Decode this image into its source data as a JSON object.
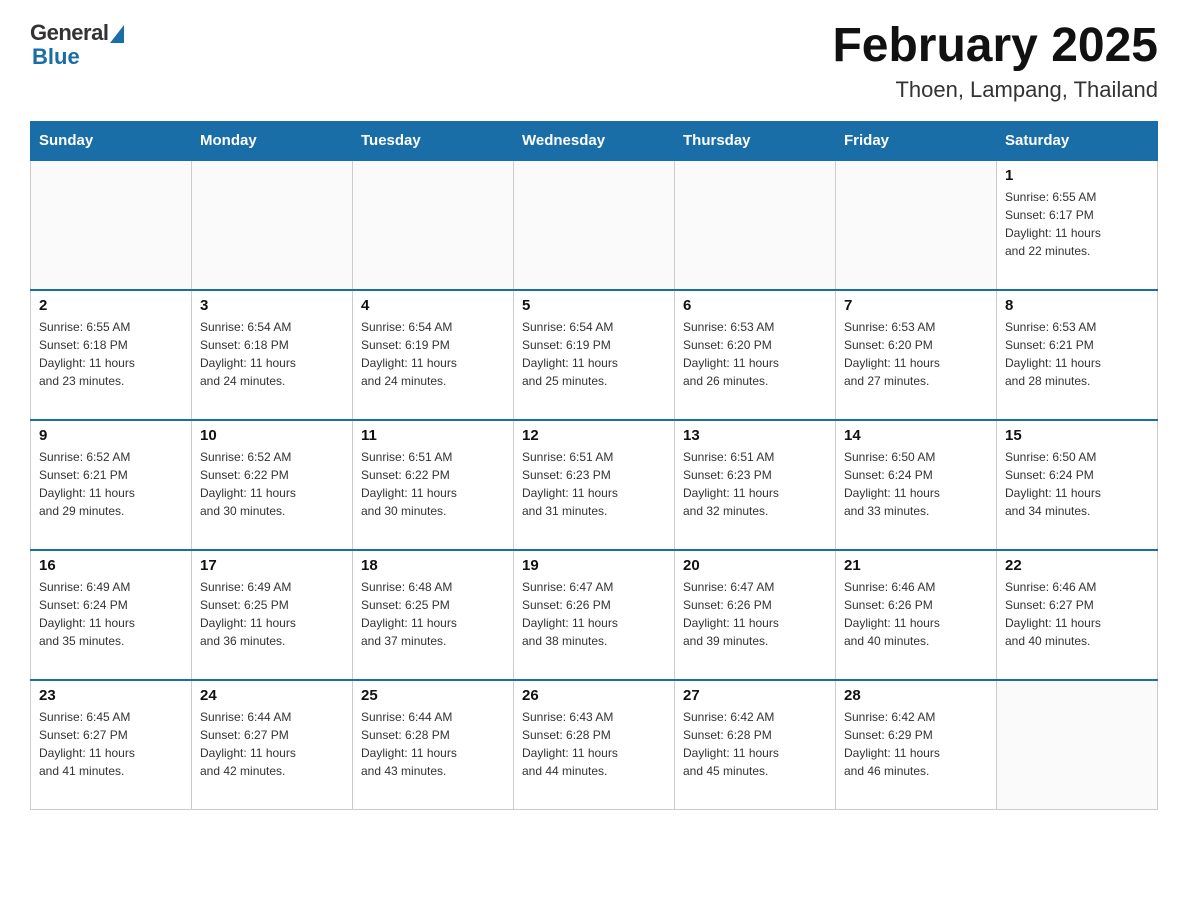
{
  "header": {
    "logo_general": "General",
    "logo_blue": "Blue",
    "month_title": "February 2025",
    "location": "Thoen, Lampang, Thailand"
  },
  "calendar": {
    "days_of_week": [
      "Sunday",
      "Monday",
      "Tuesday",
      "Wednesday",
      "Thursday",
      "Friday",
      "Saturday"
    ],
    "weeks": [
      [
        {
          "day": "",
          "info": ""
        },
        {
          "day": "",
          "info": ""
        },
        {
          "day": "",
          "info": ""
        },
        {
          "day": "",
          "info": ""
        },
        {
          "day": "",
          "info": ""
        },
        {
          "day": "",
          "info": ""
        },
        {
          "day": "1",
          "info": "Sunrise: 6:55 AM\nSunset: 6:17 PM\nDaylight: 11 hours\nand 22 minutes."
        }
      ],
      [
        {
          "day": "2",
          "info": "Sunrise: 6:55 AM\nSunset: 6:18 PM\nDaylight: 11 hours\nand 23 minutes."
        },
        {
          "day": "3",
          "info": "Sunrise: 6:54 AM\nSunset: 6:18 PM\nDaylight: 11 hours\nand 24 minutes."
        },
        {
          "day": "4",
          "info": "Sunrise: 6:54 AM\nSunset: 6:19 PM\nDaylight: 11 hours\nand 24 minutes."
        },
        {
          "day": "5",
          "info": "Sunrise: 6:54 AM\nSunset: 6:19 PM\nDaylight: 11 hours\nand 25 minutes."
        },
        {
          "day": "6",
          "info": "Sunrise: 6:53 AM\nSunset: 6:20 PM\nDaylight: 11 hours\nand 26 minutes."
        },
        {
          "day": "7",
          "info": "Sunrise: 6:53 AM\nSunset: 6:20 PM\nDaylight: 11 hours\nand 27 minutes."
        },
        {
          "day": "8",
          "info": "Sunrise: 6:53 AM\nSunset: 6:21 PM\nDaylight: 11 hours\nand 28 minutes."
        }
      ],
      [
        {
          "day": "9",
          "info": "Sunrise: 6:52 AM\nSunset: 6:21 PM\nDaylight: 11 hours\nand 29 minutes."
        },
        {
          "day": "10",
          "info": "Sunrise: 6:52 AM\nSunset: 6:22 PM\nDaylight: 11 hours\nand 30 minutes."
        },
        {
          "day": "11",
          "info": "Sunrise: 6:51 AM\nSunset: 6:22 PM\nDaylight: 11 hours\nand 30 minutes."
        },
        {
          "day": "12",
          "info": "Sunrise: 6:51 AM\nSunset: 6:23 PM\nDaylight: 11 hours\nand 31 minutes."
        },
        {
          "day": "13",
          "info": "Sunrise: 6:51 AM\nSunset: 6:23 PM\nDaylight: 11 hours\nand 32 minutes."
        },
        {
          "day": "14",
          "info": "Sunrise: 6:50 AM\nSunset: 6:24 PM\nDaylight: 11 hours\nand 33 minutes."
        },
        {
          "day": "15",
          "info": "Sunrise: 6:50 AM\nSunset: 6:24 PM\nDaylight: 11 hours\nand 34 minutes."
        }
      ],
      [
        {
          "day": "16",
          "info": "Sunrise: 6:49 AM\nSunset: 6:24 PM\nDaylight: 11 hours\nand 35 minutes."
        },
        {
          "day": "17",
          "info": "Sunrise: 6:49 AM\nSunset: 6:25 PM\nDaylight: 11 hours\nand 36 minutes."
        },
        {
          "day": "18",
          "info": "Sunrise: 6:48 AM\nSunset: 6:25 PM\nDaylight: 11 hours\nand 37 minutes."
        },
        {
          "day": "19",
          "info": "Sunrise: 6:47 AM\nSunset: 6:26 PM\nDaylight: 11 hours\nand 38 minutes."
        },
        {
          "day": "20",
          "info": "Sunrise: 6:47 AM\nSunset: 6:26 PM\nDaylight: 11 hours\nand 39 minutes."
        },
        {
          "day": "21",
          "info": "Sunrise: 6:46 AM\nSunset: 6:26 PM\nDaylight: 11 hours\nand 40 minutes."
        },
        {
          "day": "22",
          "info": "Sunrise: 6:46 AM\nSunset: 6:27 PM\nDaylight: 11 hours\nand 40 minutes."
        }
      ],
      [
        {
          "day": "23",
          "info": "Sunrise: 6:45 AM\nSunset: 6:27 PM\nDaylight: 11 hours\nand 41 minutes."
        },
        {
          "day": "24",
          "info": "Sunrise: 6:44 AM\nSunset: 6:27 PM\nDaylight: 11 hours\nand 42 minutes."
        },
        {
          "day": "25",
          "info": "Sunrise: 6:44 AM\nSunset: 6:28 PM\nDaylight: 11 hours\nand 43 minutes."
        },
        {
          "day": "26",
          "info": "Sunrise: 6:43 AM\nSunset: 6:28 PM\nDaylight: 11 hours\nand 44 minutes."
        },
        {
          "day": "27",
          "info": "Sunrise: 6:42 AM\nSunset: 6:28 PM\nDaylight: 11 hours\nand 45 minutes."
        },
        {
          "day": "28",
          "info": "Sunrise: 6:42 AM\nSunset: 6:29 PM\nDaylight: 11 hours\nand 46 minutes."
        },
        {
          "day": "",
          "info": ""
        }
      ]
    ]
  }
}
